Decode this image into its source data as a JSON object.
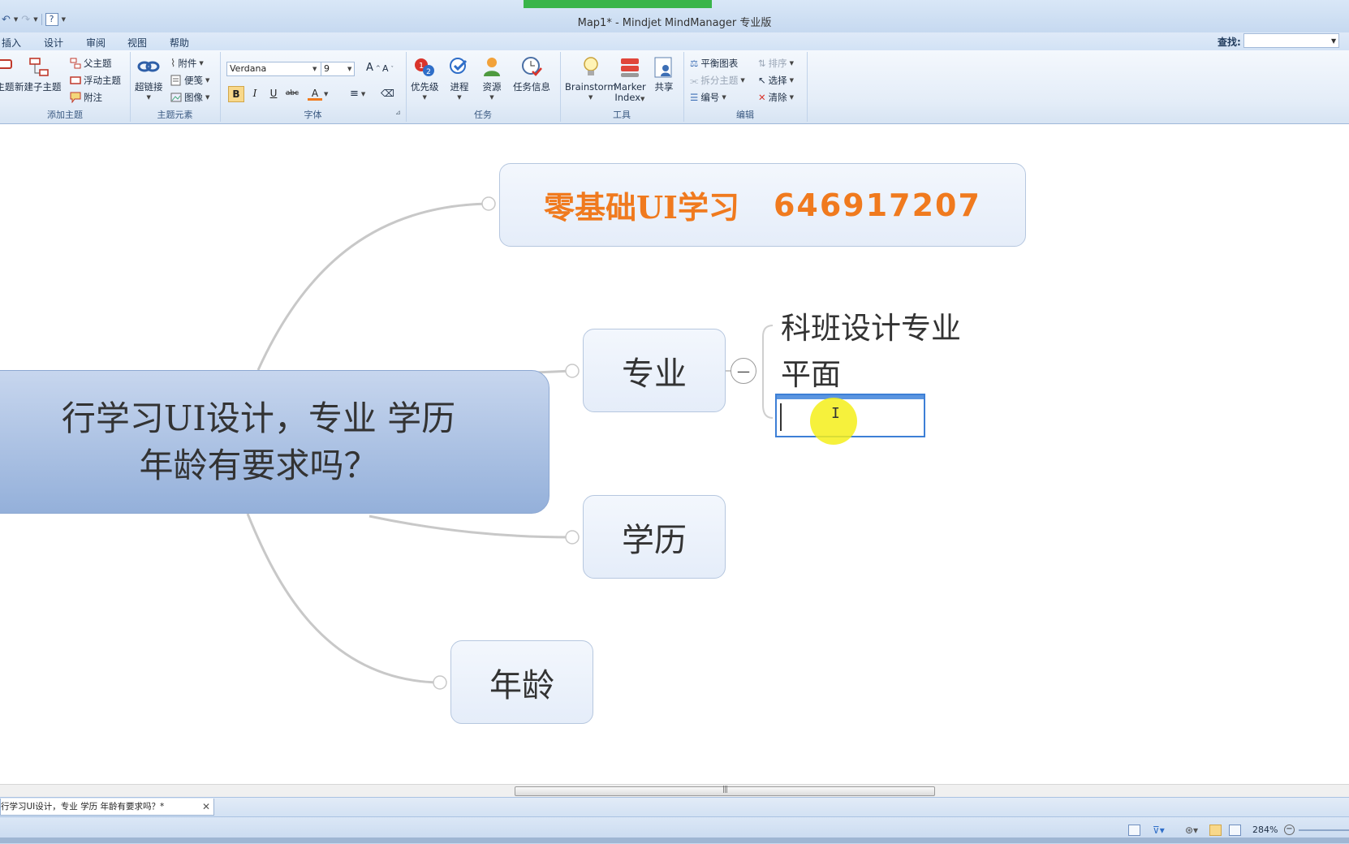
{
  "window": {
    "title": "Map1* - Mindjet MindManager 专业版",
    "qat_undo": "↶",
    "qat_redo": "↷",
    "qat_help": "?"
  },
  "menu": {
    "tabs": [
      "插入",
      "设计",
      "审阅",
      "视图",
      "帮助"
    ],
    "find_label": "查找:",
    "find_value": ""
  },
  "ribbon": {
    "groups": {
      "add_topic": {
        "label": "添加主题",
        "topic_partial": "主题",
        "new_subtopic": "新建子主题",
        "parent_topic": "父主题",
        "floating_topic": "浮动主题",
        "callout": "附注"
      },
      "topic_elements": {
        "label": "主题元素",
        "hyperlink": "超链接",
        "attachment": "附件",
        "notes": "便笺",
        "image": "图像"
      },
      "font": {
        "label": "字体",
        "font_name": "Verdana",
        "font_size": "9",
        "bold": "B",
        "italic": "I",
        "underline": "U",
        "strike": "abc",
        "color": "A"
      },
      "task": {
        "label": "任务",
        "priority": "优先级",
        "progress": "进程",
        "resource": "资源",
        "task_info": "任务信息"
      },
      "tools": {
        "label": "工具",
        "brainstorm": "Brainstorm",
        "marker_index_1": "Marker",
        "marker_index_2": "Index",
        "share": "共享"
      },
      "edit": {
        "label": "编辑",
        "balance_map": "平衡图表",
        "split_topic": "拆分主题",
        "numbering": "编号",
        "sort": "排序",
        "select": "选择",
        "clear": "清除"
      }
    }
  },
  "map": {
    "central_line1": "行学习UI设计，专业 学历",
    "central_line2": "年龄有要求吗？",
    "banner_text": "零基础UI学习",
    "banner_number": "646917207",
    "topics": {
      "major": "专业",
      "education": "学历",
      "age": "年龄"
    },
    "subtopics": {
      "sub1": "科班设计专业",
      "sub2": "平面"
    },
    "edit_value": "",
    "collapse_symbol": "—"
  },
  "document_tab": {
    "label": "行学习UI设计，专业 学历 年龄有要求吗？*",
    "close": "✕"
  },
  "status": {
    "zoom": "284%",
    "zoom_minus": "−"
  },
  "colors": {
    "accent_orange": "#f07a1e",
    "central_fill": "#a7bfe3",
    "topic_fill": "#e9f0fa",
    "edit_border": "#3d7fd6",
    "cursor_highlight": "#f5ef1a"
  }
}
